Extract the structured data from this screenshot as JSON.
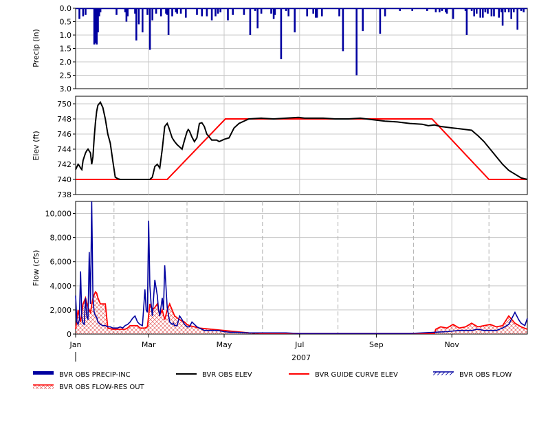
{
  "chart_data": [
    {
      "id": "precip",
      "type": "bar",
      "ylabel": "Precip (in)",
      "ylim": [
        3.0,
        0.0
      ],
      "y_inverted": true,
      "yticks": [
        "0.0",
        "0.5",
        "1.0",
        "1.5",
        "2.0",
        "2.5",
        "3.0"
      ],
      "ytick_values": [
        0.0,
        0.5,
        1.0,
        1.5,
        2.0,
        2.5,
        3.0
      ],
      "color": "#0000a0",
      "x_day": [
        3,
        6,
        8,
        15,
        16,
        17,
        18,
        19,
        20,
        33,
        40,
        41,
        42,
        48,
        49,
        51,
        54,
        58,
        60,
        62,
        65,
        69,
        73,
        74,
        75,
        78,
        81,
        82,
        85,
        89,
        98,
        102,
        106,
        110,
        113,
        115,
        117,
        123,
        127,
        136,
        141,
        145,
        147,
        150,
        158,
        160,
        161,
        166,
        170,
        172,
        177,
        187,
        192,
        194,
        195,
        199,
        213,
        216,
        227,
        232,
        246,
        250,
        262,
        272,
        284,
        291,
        294,
        296,
        299,
        300,
        305,
        315,
        316,
        320,
        322,
        324,
        327,
        329,
        331,
        333,
        336,
        338,
        342,
        344,
        345,
        347,
        350,
        352,
        354,
        357,
        360,
        362
      ],
      "values": [
        0.4,
        0.3,
        0.25,
        1.35,
        1.3,
        1.35,
        0.9,
        0.3,
        0.15,
        0.25,
        0.15,
        0.5,
        0.3,
        0.2,
        1.2,
        0.6,
        0.9,
        0.25,
        1.55,
        0.45,
        0.2,
        0.3,
        0.2,
        0.25,
        1.0,
        0.3,
        0.15,
        0.2,
        0.2,
        0.35,
        0.25,
        0.3,
        0.3,
        0.45,
        0.3,
        0.2,
        0.15,
        0.45,
        0.25,
        0.25,
        1.0,
        0.1,
        0.75,
        0.2,
        0.2,
        0.4,
        0.25,
        1.9,
        0.1,
        0.3,
        0.9,
        0.3,
        0.2,
        0.35,
        0.35,
        0.3,
        0.3,
        1.6,
        2.5,
        0.85,
        0.95,
        0.3,
        0.1,
        0.1,
        0.1,
        0.15,
        0.15,
        0.1,
        0.15,
        0.2,
        0.4,
        0.1,
        1.0,
        0.1,
        0.3,
        0.2,
        0.35,
        0.35,
        0.15,
        0.2,
        0.3,
        0.3,
        0.35,
        0.15,
        0.65,
        0.15,
        0.15,
        0.4,
        0.15,
        0.8,
        0.1,
        0.15
      ]
    },
    {
      "id": "elev",
      "type": "line",
      "ylabel": "Elev (ft)",
      "ylim": [
        738,
        751
      ],
      "yticks": [
        "738",
        "740",
        "742",
        "744",
        "746",
        "748",
        "750"
      ],
      "ytick_values": [
        738,
        740,
        742,
        744,
        746,
        748,
        750
      ],
      "series": [
        {
          "name": "BVR OBS ELEV",
          "color": "#000000",
          "x_day": [
            0,
            2,
            3,
            4,
            5,
            6,
            8,
            9,
            10,
            12,
            13,
            14,
            15,
            16,
            17,
            18,
            20,
            22,
            24,
            26,
            28,
            30,
            32,
            34,
            36,
            38,
            42,
            48,
            55,
            60,
            62,
            64,
            66,
            68,
            70,
            72,
            74,
            75,
            76,
            78,
            80,
            82,
            84,
            86,
            88,
            90,
            91,
            92,
            94,
            96,
            98,
            100,
            102,
            104,
            106,
            110,
            112,
            114,
            116,
            120,
            124,
            128,
            132,
            140,
            150,
            160,
            170,
            180,
            185,
            190,
            200,
            210,
            220,
            230,
            240,
            250,
            260,
            270,
            280,
            285,
            290,
            295,
            300,
            305,
            310,
            315,
            320,
            325,
            330,
            335,
            340,
            345,
            350,
            355,
            360,
            365
          ],
          "values": [
            741.3,
            742.0,
            741.8,
            741.5,
            741.3,
            742.5,
            743.5,
            743.8,
            744.0,
            743.5,
            742.0,
            743.0,
            745.5,
            747.5,
            749.0,
            749.8,
            750.2,
            749.5,
            748.0,
            746.0,
            744.8,
            742.5,
            740.3,
            740.1,
            740.0,
            740.0,
            740.0,
            740.0,
            740.0,
            740.0,
            740.3,
            741.7,
            742.0,
            741.5,
            744.0,
            747.0,
            747.4,
            747.0,
            746.5,
            745.5,
            745.0,
            744.6,
            744.3,
            744.0,
            745.2,
            746.3,
            746.6,
            746.4,
            745.6,
            745.0,
            745.5,
            747.4,
            747.5,
            747.0,
            746.0,
            745.2,
            745.2,
            745.2,
            745.0,
            745.3,
            745.5,
            746.8,
            747.4,
            748.0,
            748.1,
            748.0,
            748.1,
            748.2,
            748.1,
            748.1,
            748.1,
            748.0,
            748.0,
            748.1,
            747.9,
            747.7,
            747.6,
            747.4,
            747.3,
            747.1,
            747.2,
            747.0,
            746.9,
            746.8,
            746.7,
            746.6,
            746.5,
            745.8,
            745.0,
            744.0,
            743.0,
            742.0,
            741.2,
            740.7,
            740.2,
            740.0,
            740.4,
            740.6,
            740.2,
            740.4,
            740.1,
            740.0,
            740.0
          ],
          "_note_trim": true
        },
        {
          "name": "BVR GUIDE CURVE ELEV",
          "color": "#ff0000",
          "x_day": [
            0,
            75,
            120,
            365
          ],
          "values": [
            740,
            740,
            748,
            748
          ],
          "x_day_full": [
            0,
            74,
            121,
            288,
            334,
            365
          ],
          "values_full": [
            740,
            740,
            748,
            748,
            740,
            740
          ]
        }
      ]
    },
    {
      "id": "flow",
      "type": "line",
      "ylabel": "Flow (cfs)",
      "ylim": [
        0,
        11000
      ],
      "yticks": [
        "0",
        "2,000",
        "4,000",
        "6,000",
        "8,000",
        "10,000"
      ],
      "ytick_values": [
        0,
        2000,
        4000,
        6000,
        8000,
        10000
      ],
      "xticks": [
        "Jan",
        "Mar",
        "May",
        "Jul",
        "Sep",
        "Nov"
      ],
      "xtick_days": [
        0,
        59,
        120,
        181,
        243,
        304
      ],
      "year_label": "2007",
      "series": [
        {
          "name": "BVR OBS FLOW",
          "color": "#0000a0",
          "x_day": [
            0,
            1,
            2,
            3,
            4,
            5,
            6,
            7,
            8,
            9,
            10,
            11,
            12,
            13,
            14,
            15,
            16,
            17,
            18,
            19,
            20,
            22,
            24,
            26,
            28,
            30,
            32,
            34,
            36,
            38,
            40,
            42,
            44,
            46,
            48,
            50,
            52,
            54,
            56,
            57,
            58,
            59,
            60,
            61,
            62,
            64,
            66,
            67,
            68,
            70,
            71,
            72,
            74,
            76,
            78,
            79,
            80,
            82,
            84,
            86,
            87,
            88,
            89,
            90,
            92,
            94,
            96,
            98,
            100,
            102,
            104,
            106,
            108,
            110,
            115,
            120,
            125,
            130,
            140,
            150,
            160,
            170,
            180,
            190,
            200,
            210,
            220,
            230,
            240,
            250,
            255,
            260,
            270,
            280,
            290,
            300,
            310,
            315,
            320,
            325,
            330,
            335,
            340,
            345,
            350,
            355,
            358,
            360,
            363,
            365
          ],
          "values": [
            3200,
            1000,
            800,
            1200,
            5200,
            1400,
            900,
            800,
            3000,
            1500,
            1200,
            6800,
            2500,
            11000,
            3000,
            1800,
            1500,
            1400,
            1000,
            900,
            800,
            700,
            700,
            600,
            600,
            500,
            500,
            500,
            600,
            500,
            700,
            800,
            1000,
            1300,
            1500,
            1000,
            800,
            700,
            3700,
            2000,
            1800,
            9400,
            4000,
            2500,
            1500,
            4500,
            3200,
            2000,
            1500,
            3000,
            2000,
            5700,
            2200,
            1000,
            800,
            900,
            700,
            700,
            1500,
            1200,
            1000,
            800,
            700,
            600,
            600,
            1000,
            800,
            600,
            500,
            400,
            300,
            300,
            300,
            300,
            300,
            200,
            150,
            150,
            100,
            100,
            100,
            100,
            50,
            50,
            50,
            50,
            50,
            50,
            50,
            50,
            50,
            50,
            50,
            100,
            150,
            200,
            300,
            300,
            300,
            400,
            300,
            300,
            300,
            500,
            800,
            1800,
            1200,
            900,
            700,
            1300,
            600,
            400
          ]
        },
        {
          "name": "BVR OBS FLOW-RES OUT",
          "color": "#ff0000",
          "x_day": [
            0,
            2,
            4,
            6,
            8,
            10,
            12,
            14,
            16,
            17,
            18,
            20,
            22,
            24,
            26,
            30,
            40,
            42,
            44,
            50,
            52,
            56,
            58,
            60,
            62,
            64,
            66,
            68,
            70,
            72,
            74,
            76,
            78,
            80,
            84,
            88,
            90,
            92,
            100,
            110,
            120,
            130,
            140,
            150,
            160,
            170,
            180,
            190,
            200,
            210,
            220,
            230,
            240,
            250,
            260,
            270,
            280,
            290,
            291,
            295,
            300,
            305,
            310,
            315,
            320,
            325,
            330,
            335,
            340,
            345,
            350,
            355,
            360,
            365
          ],
          "values": [
            400,
            2000,
            1000,
            2500,
            3000,
            2200,
            1800,
            3000,
            3500,
            3400,
            3000,
            2500,
            2500,
            2500,
            500,
            400,
            400,
            500,
            700,
            700,
            500,
            500,
            600,
            2500,
            2000,
            2200,
            2500,
            1600,
            2000,
            1200,
            2000,
            2500,
            2000,
            1500,
            1200,
            1000,
            800,
            700,
            500,
            400,
            300,
            200,
            100,
            50,
            50,
            50,
            50,
            50,
            50,
            50,
            50,
            50,
            50,
            50,
            50,
            50,
            50,
            50,
            400,
            600,
            500,
            800,
            500,
            600,
            900,
            600,
            700,
            800,
            600,
            700,
            1500,
            900,
            600,
            400
          ]
        }
      ]
    }
  ],
  "legend": [
    {
      "label": "BVR OBS PRECIP-INC",
      "style": "thick-bar",
      "color": "#0000a0"
    },
    {
      "label": "BVR OBS ELEV",
      "style": "line",
      "color": "#000000"
    },
    {
      "label": "BVR GUIDE CURVE ELEV",
      "style": "line",
      "color": "#ff0000"
    },
    {
      "label": "BVR OBS FLOW",
      "style": "hatched-line",
      "color": "#0000a0"
    },
    {
      "label": "BVR OBS FLOW-RES OUT",
      "style": "hatched-line",
      "color": "#ff0000"
    }
  ]
}
